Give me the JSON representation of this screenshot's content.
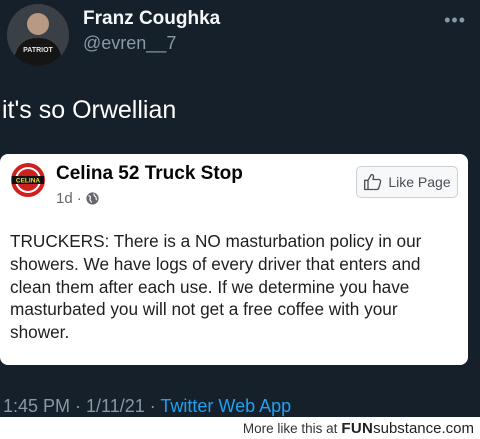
{
  "tweet": {
    "display_name": "Franz Coughka",
    "handle": "@evren__7",
    "more_label": "•••",
    "text": "it's so Orwellian",
    "footer": {
      "time_date": "1:45 PM · 1/11/21 · ",
      "source": "Twitter Web App"
    }
  },
  "embed": {
    "page_name": "Celina 52 Truck Stop",
    "age": "1d",
    "separator": "·",
    "like_button_label": "Like Page",
    "body": "TRUCKERS: There is a NO masturbation policy in our showers. We have logs of every driver that enters and clean them after each use. If we determine you have masturbated you will not get a free coffee with your shower.",
    "logo_text": "CELINA"
  },
  "watermark": {
    "prefix": "More like this at",
    "brand_bold": "FUN",
    "brand_rest": "substance.com"
  },
  "avatar_shirt_text": "PATRIOT",
  "colors": {
    "background": "#15202b",
    "secondary_text": "#8899a6",
    "link": "#1da1f2",
    "card": "#ffffff"
  }
}
